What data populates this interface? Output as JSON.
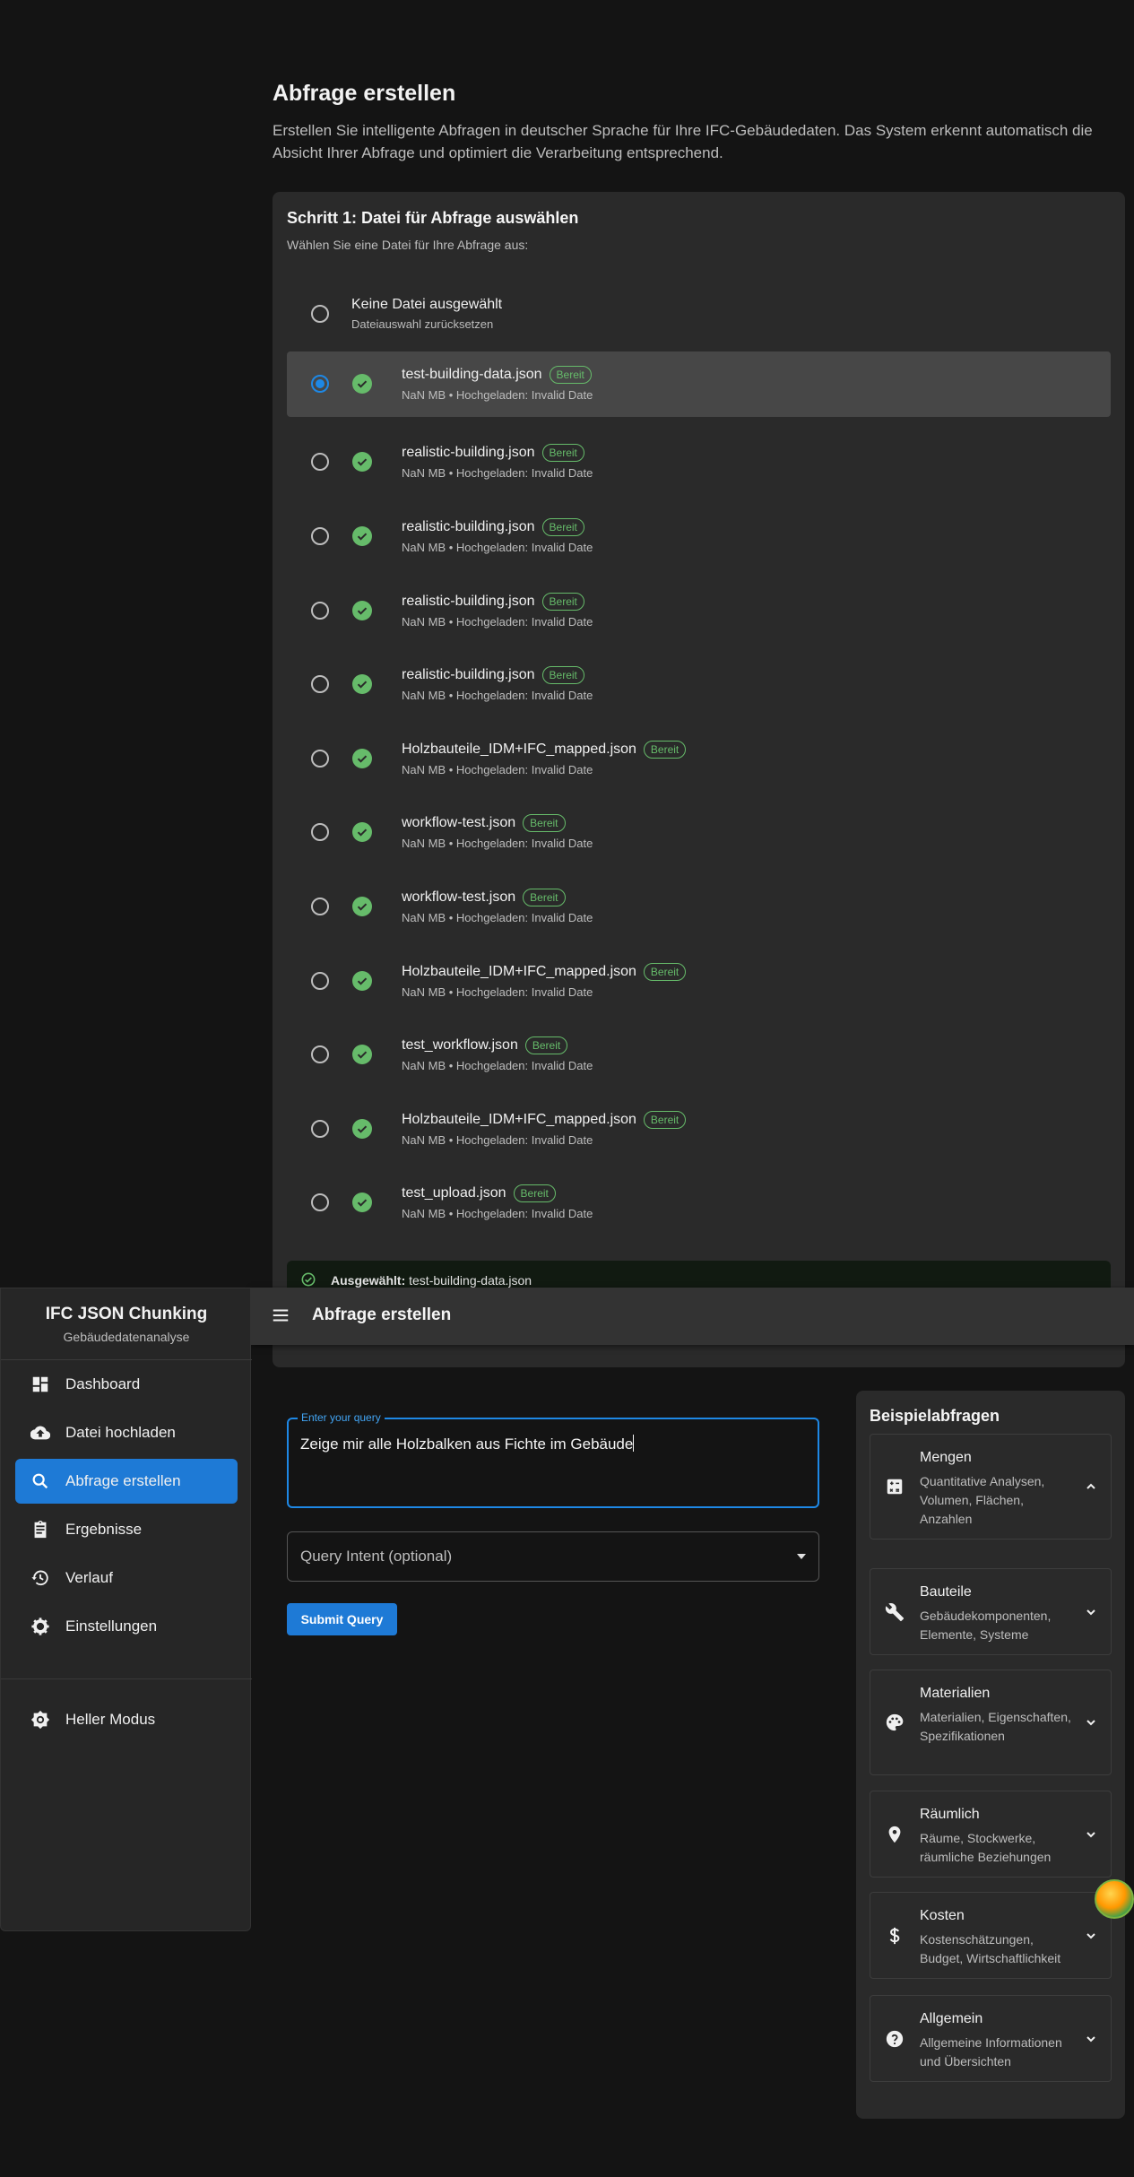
{
  "page": {
    "title": "Abfrage erstellen",
    "description": "Erstellen Sie intelligente Abfragen in deutscher Sprache für Ihre IFC-Gebäudedaten. Das System erkennt automatisch die Absicht Ihrer Abfrage und optimiert die Verarbeitung entsprechend."
  },
  "step1": {
    "title": "Schritt 1: Datei für Abfrage auswählen",
    "subtitle": "Wählen Sie eine Datei für Ihre Abfrage aus:",
    "none_option": {
      "title": "Keine Datei ausgewählt",
      "subtitle": "Dateiauswahl zurücksetzen"
    },
    "files": [
      {
        "name": "test-building-data.json",
        "badge": "Bereit",
        "meta": "NaN MB • Hochgeladen: Invalid Date",
        "selected": true
      },
      {
        "name": "realistic-building.json",
        "badge": "Bereit",
        "meta": "NaN MB • Hochgeladen: Invalid Date",
        "selected": false
      },
      {
        "name": "realistic-building.json",
        "badge": "Bereit",
        "meta": "NaN MB • Hochgeladen: Invalid Date",
        "selected": false
      },
      {
        "name": "realistic-building.json",
        "badge": "Bereit",
        "meta": "NaN MB • Hochgeladen: Invalid Date",
        "selected": false
      },
      {
        "name": "realistic-building.json",
        "badge": "Bereit",
        "meta": "NaN MB • Hochgeladen: Invalid Date",
        "selected": false
      },
      {
        "name": "Holzbauteile_IDM+IFC_mapped.json",
        "badge": "Bereit",
        "meta": "NaN MB • Hochgeladen: Invalid Date",
        "selected": false
      },
      {
        "name": "workflow-test.json",
        "badge": "Bereit",
        "meta": "NaN MB • Hochgeladen: Invalid Date",
        "selected": false
      },
      {
        "name": "workflow-test.json",
        "badge": "Bereit",
        "meta": "NaN MB • Hochgeladen: Invalid Date",
        "selected": false
      },
      {
        "name": "Holzbauteile_IDM+IFC_mapped.json",
        "badge": "Bereit",
        "meta": "NaN MB • Hochgeladen: Invalid Date",
        "selected": false
      },
      {
        "name": "test_workflow.json",
        "badge": "Bereit",
        "meta": "NaN MB • Hochgeladen: Invalid Date",
        "selected": false
      },
      {
        "name": "Holzbauteile_IDM+IFC_mapped.json",
        "badge": "Bereit",
        "meta": "NaN MB • Hochgeladen: Invalid Date",
        "selected": false
      },
      {
        "name": "test_upload.json",
        "badge": "Bereit",
        "meta": "NaN MB • Hochgeladen: Invalid Date",
        "selected": false
      }
    ],
    "selected_label": "Ausgewählt:",
    "selected_value": "test-building-data.json"
  },
  "appbar": {
    "title": "Abfrage erstellen",
    "menu_icon": "hamburger-menu-icon"
  },
  "sidebar": {
    "title": "IFC JSON Chunking",
    "subtitle": "Gebäudedatenanalyse",
    "items": [
      {
        "label": "Dashboard",
        "icon": "dashboard-icon",
        "active": false
      },
      {
        "label": "Datei hochladen",
        "icon": "cloud-upload-icon",
        "active": false
      },
      {
        "label": "Abfrage erstellen",
        "icon": "search-icon",
        "active": true
      },
      {
        "label": "Ergebnisse",
        "icon": "clipboard-icon",
        "active": false
      },
      {
        "label": "Verlauf",
        "icon": "history-icon",
        "active": false
      },
      {
        "label": "Einstellungen",
        "icon": "gear-icon",
        "active": false
      }
    ],
    "mode_toggle": {
      "label": "Heller Modus",
      "icon": "brightness-icon"
    }
  },
  "query": {
    "label": "Enter your query",
    "value": "Zeige mir alle Holzbalken aus Fichte im Gebäude",
    "intent_placeholder": "Query Intent (optional)",
    "submit_label": "Submit Query"
  },
  "examples": {
    "title": "Beispielabfragen",
    "categories": [
      {
        "name": "Mengen",
        "description": "Quantitative Analysen, Volumen, Flächen, Anzahlen",
        "icon": "calculator-icon",
        "expanded": true
      },
      {
        "name": "Bauteile",
        "description": "Gebäudekomponenten, Elemente, Systeme",
        "icon": "wrench-icon",
        "expanded": false
      },
      {
        "name": "Materialien",
        "description": "Materialien, Eigenschaften, Spezifikationen",
        "icon": "palette-icon",
        "expanded": false
      },
      {
        "name": "Räumlich",
        "description": "Räume, Stockwerke, räumliche Beziehungen",
        "icon": "location-pin-icon",
        "expanded": false
      },
      {
        "name": "Kosten",
        "description": "Kostenschätzungen, Budget, Wirtschaftlichkeit",
        "icon": "dollar-icon",
        "expanded": false
      },
      {
        "name": "Allgemein",
        "description": "Allgemeine Informationen und Übersichten",
        "icon": "help-icon",
        "expanded": false
      }
    ]
  },
  "colors": {
    "accent": "#1e7ad6",
    "success": "#66bb6a",
    "background": "#141414",
    "surface": "#2a2a2a"
  }
}
